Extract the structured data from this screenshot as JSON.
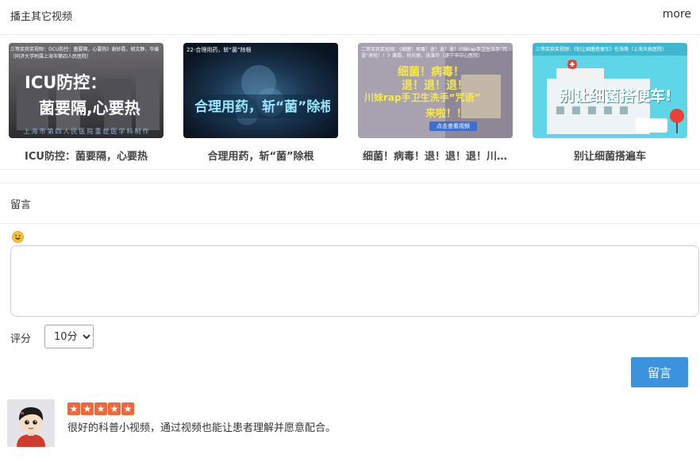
{
  "header": {
    "title": "播主其它视频",
    "more_label": "more"
  },
  "videos": [
    {
      "title": "ICU防控：菌要隔，心要热",
      "thumb_caption": "三等奖获奖视频：《ICU防控：菌要隔，心要热》谢妙霞，胡文静，毕媛（同济大学附属上海市第四人民医院）",
      "thumb_text_1": "ICU防控：",
      "thumb_text_2": "菌要隔,心要热",
      "thumb_footer": "上海市第四人民医院重症医学科制作"
    },
    {
      "title": "合理用药，斩“菌”除根",
      "thumb_caption": "22-合理用药，斩“菌”除根",
      "thumb_text_1": "合理用药，斩“菌”除根"
    },
    {
      "title": "细菌！病毒！退！退！退！川妹rap手卫生洗手“咒语”来啦！！",
      "thumb_caption": "二等奖获奖视频：《细菌！病毒！退！退！退！川妹rap手卫生洗手“咒语”来啦！！》黄霞，何光丽，张湛华（遂宁市中心医院）",
      "thumb_text_1": "细菌！病毒！",
      "thumb_text_2": "退！退！退！",
      "thumb_text_3": "川妹rap手卫生洗手“咒语”",
      "thumb_text_4": "来啦！！",
      "thumb_overlay": "点击查看视频"
    },
    {
      "title": "别让细菌搭遍车",
      "thumb_caption": "三等奖获奖视频：《别让细菌搭便车》任海燕（上海天佑医院）",
      "thumb_text_1": "别让细菌搭便车!"
    }
  ],
  "comment": {
    "label": "留言",
    "emoji_icon": "grinning-face-emoji",
    "textarea_value": "",
    "textarea_placeholder": ""
  },
  "rating": {
    "label": "评分",
    "selected": "10分",
    "options": [
      "10分"
    ]
  },
  "submit": {
    "label": "留言"
  },
  "review": {
    "stars": 5,
    "text": "很好的科普小视频，通过视频也能让患者理解并愿意配合。"
  },
  "colors": {
    "accent": "#3a93dc",
    "star": "#f1673a",
    "border": "#ececec"
  }
}
